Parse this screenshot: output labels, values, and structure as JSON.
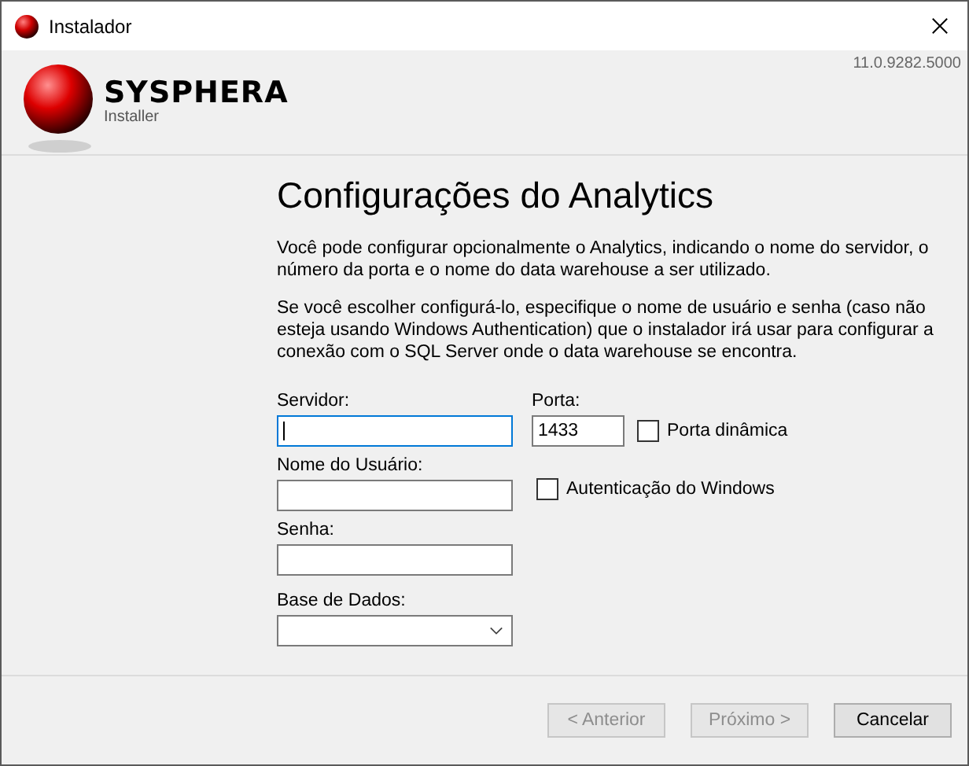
{
  "window": {
    "title": "Instalador"
  },
  "header": {
    "brand": "SYSPHERA",
    "subtitle": "Installer",
    "version": "11.0.9282.5000"
  },
  "page": {
    "title": "Configurações do Analytics",
    "paragraphs": [
      "Você pode configurar opcionalmente o Analytics, indicando o nome do servidor, o número da porta e o nome do data warehouse a ser utilizado.",
      "Se você escolher configurá-lo, especifique o nome de usuário e senha (caso não esteja usando Windows Authentication) que o instalador irá usar para configurar a conexão com o SQL Server onde o data warehouse se encontra."
    ]
  },
  "form": {
    "server": {
      "label": "Servidor:",
      "focused": true
    },
    "port": {
      "label": "Porta:",
      "value": "1433"
    },
    "dynamic_port": {
      "label": "Porta dinâmica",
      "checked": false
    },
    "user": {
      "label": "Nome do Usuário:"
    },
    "windows_auth": {
      "label": "Autenticação do Windows",
      "checked": false
    },
    "password": {
      "label": "Senha:"
    },
    "database": {
      "label": "Base de Dados:"
    }
  },
  "buttons": [
    {
      "label": "< Anterior",
      "disabled": true
    },
    {
      "label": "Próximo >",
      "disabled": true
    },
    {
      "label": "Cancelar",
      "disabled": false
    }
  ]
}
